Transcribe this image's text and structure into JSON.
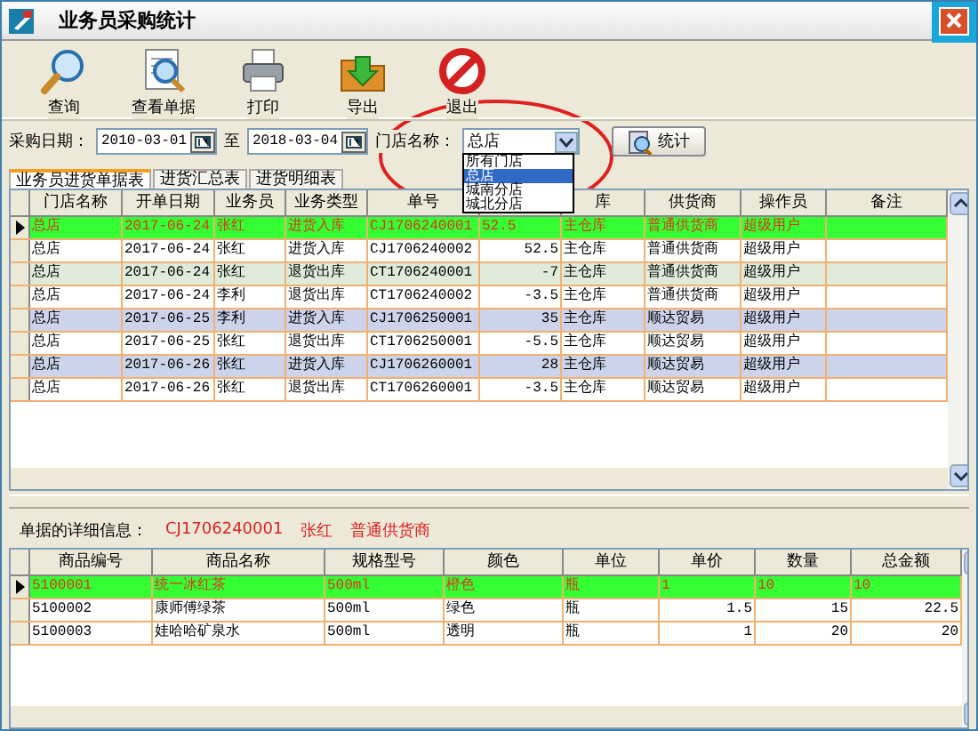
{
  "window": {
    "title": "业务员采购统计"
  },
  "toolbar": [
    {
      "label": "查询",
      "kind": "search"
    },
    {
      "label": "查看单据",
      "kind": "view"
    },
    {
      "label": "打印",
      "kind": "print"
    },
    {
      "label": "导出",
      "kind": "export"
    },
    {
      "label": "退出",
      "kind": "exit"
    }
  ],
  "filter": {
    "date_label": "采购日期：",
    "date_from": "2010-03-01",
    "to_label": "至",
    "date_to": "2018-03-04",
    "store_label": "门店名称：",
    "store_value": "总店",
    "button": "统计",
    "store_options": [
      {
        "label": "所有门店",
        "selected": false
      },
      {
        "label": "总店",
        "selected": true
      },
      {
        "label": "城南分店",
        "selected": false
      },
      {
        "label": "城北分店",
        "selected": false
      }
    ]
  },
  "tabs": [
    {
      "label": "业务员进货单据表",
      "selected": true
    },
    {
      "label": "进货汇总表",
      "selected": false
    },
    {
      "label": "进货明细表",
      "selected": false
    }
  ],
  "table": {
    "columns": [
      {
        "label": "门店名称"
      },
      {
        "label": "开单日期"
      },
      {
        "label": "业务员"
      },
      {
        "label": "业务类型"
      },
      {
        "label": "单号"
      },
      {},
      {
        "label": "库"
      },
      {
        "label": "供货商"
      },
      {
        "label": "操作员"
      },
      {
        "label": "备注"
      }
    ],
    "rows": [
      {
        "selected": true,
        "cells": [
          "总店",
          "2017-06-24",
          "张红",
          "进货入库",
          "CJ1706240001",
          "52.5",
          "主仓库",
          "普通供货商",
          "超级用户",
          ""
        ]
      },
      {
        "selected": false,
        "cells": [
          "总店",
          "2017-06-24",
          "张红",
          "进货入库",
          "CJ1706240002",
          "52.5",
          "主仓库",
          "普通供货商",
          "超级用户",
          ""
        ]
      },
      {
        "selected": false,
        "color": "#dfeadb",
        "cells": [
          "总店",
          "2017-06-24",
          "张红",
          "退货出库",
          "CT1706240001",
          "-7",
          "主仓库",
          "普通供货商",
          "超级用户",
          ""
        ]
      },
      {
        "selected": false,
        "cells": [
          "总店",
          "2017-06-24",
          "李利",
          "退货出库",
          "CT1706240002",
          "-3.5",
          "主仓库",
          "普通供货商",
          "超级用户",
          ""
        ]
      },
      {
        "selected": false,
        "color": "#ccd3ea",
        "cells": [
          "总店",
          "2017-06-25",
          "李利",
          "进货入库",
          "CJ1706250001",
          "35",
          "主仓库",
          "顺达贸易",
          "超级用户",
          ""
        ]
      },
      {
        "selected": false,
        "cells": [
          "总店",
          "2017-06-25",
          "张红",
          "退货出库",
          "CT1706250001",
          "-5.5",
          "主仓库",
          "顺达贸易",
          "超级用户",
          ""
        ]
      },
      {
        "selected": false,
        "color": "#ccd3ea",
        "cells": [
          "总店",
          "2017-06-26",
          "张红",
          "进货入库",
          "CJ1706260001",
          "28",
          "主仓库",
          "顺达贸易",
          "超级用户",
          ""
        ]
      },
      {
        "selected": false,
        "cells": [
          "总店",
          "2017-06-26",
          "张红",
          "退货出库",
          "CT1706260001",
          "-3.5",
          "主仓库",
          "顺达贸易",
          "超级用户",
          ""
        ]
      }
    ]
  },
  "detail": {
    "label": "单据的详细信息：",
    "order_no": "CJ1706240001",
    "salesman": "张红",
    "supplier": "普通供货商",
    "columns": [
      "商品编号",
      "商品名称",
      "规格型号",
      "颜色",
      "单位",
      "单价",
      "数量",
      "总金额"
    ],
    "rows": [
      {
        "selected": true,
        "cells": [
          "5100001",
          "统一冰红茶",
          "500ml",
          "橙色",
          "瓶",
          "1",
          "10",
          "10"
        ]
      },
      {
        "selected": false,
        "cells": [
          "5100002",
          "康师傅绿茶",
          "500ml",
          "绿色",
          "瓶",
          "1.5",
          "15",
          "22.5"
        ]
      },
      {
        "selected": false,
        "cells": [
          "5100003",
          "娃哈哈矿泉水",
          "500ml",
          "透明",
          "瓶",
          "1",
          "20",
          "20"
        ]
      }
    ]
  }
}
